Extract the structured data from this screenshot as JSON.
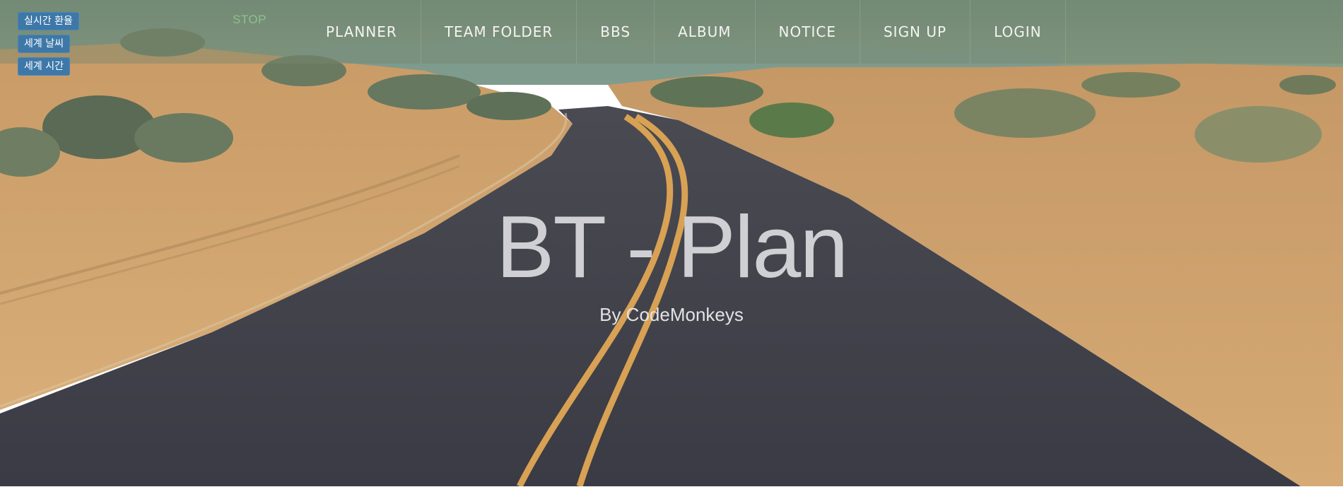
{
  "widgets": {
    "exchange_rate": "실시간 환율",
    "world_weather": "세계 날씨",
    "world_time": "세계 시간"
  },
  "stop_label": "STOP",
  "nav": {
    "items": [
      {
        "label": "PLANNER"
      },
      {
        "label": "TEAM FOLDER"
      },
      {
        "label": "BBS"
      },
      {
        "label": "ALBUM"
      },
      {
        "label": "NOTICE"
      },
      {
        "label": "SIGN UP"
      },
      {
        "label": "LOGIN"
      }
    ]
  },
  "hero": {
    "title": "BT - Plan",
    "subtitle": "By CodeMonkeys",
    "background": "desert-road-photo"
  },
  "colors": {
    "sky": "#7f9a86",
    "sand": "#d2a46e",
    "road": "#3e3f47",
    "road_line": "#d8a154",
    "widget_button": "#3e78a8",
    "stop_text": "#8fc08a",
    "nav_text": "#f4f4f2"
  }
}
